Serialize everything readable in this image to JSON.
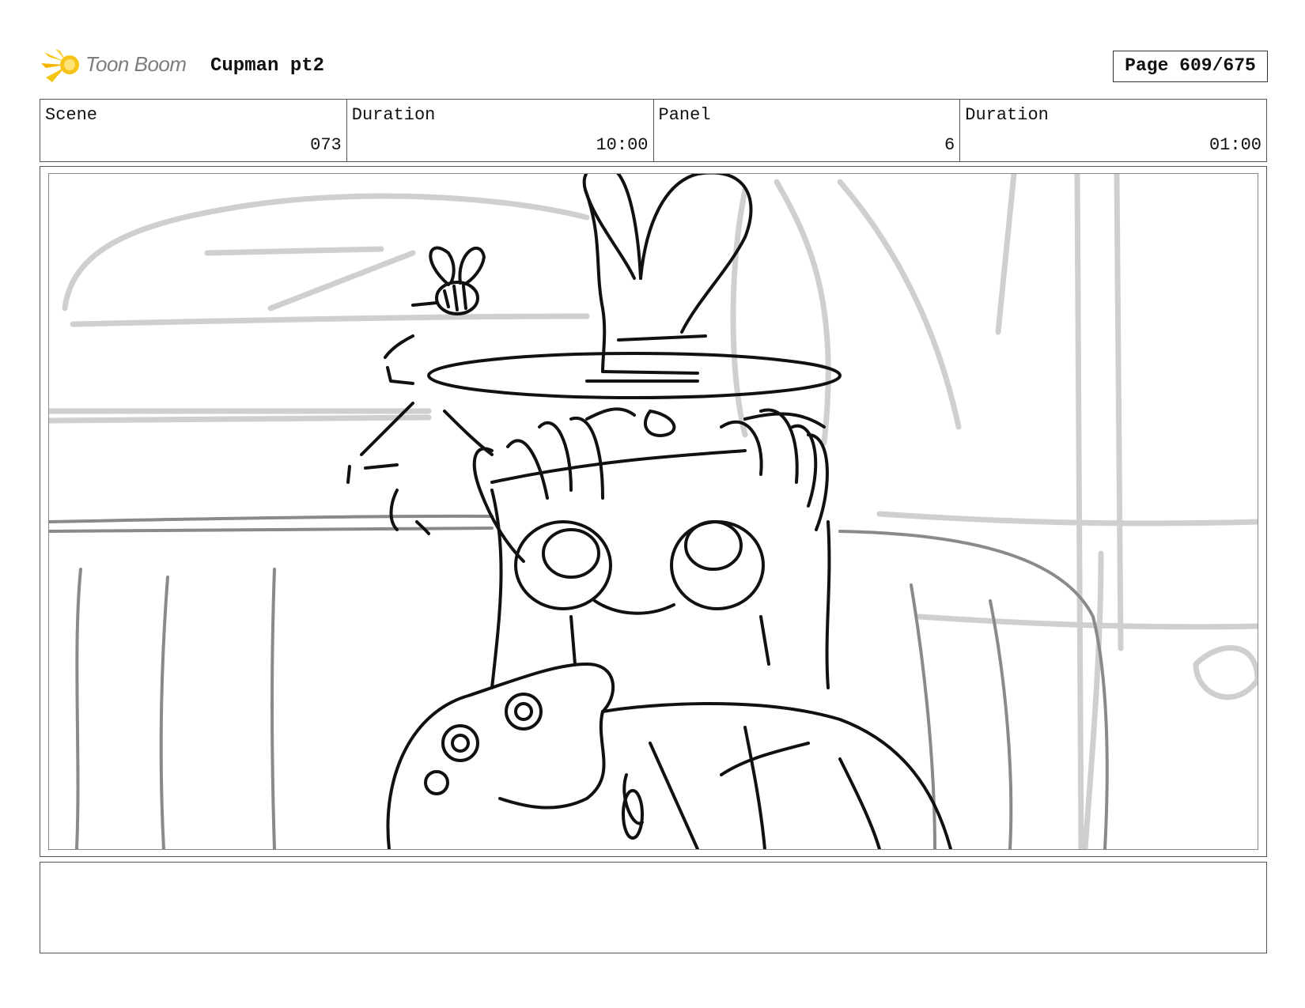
{
  "header": {
    "logo_text": "Toon Boom",
    "project_title": "Cupman pt2",
    "page_label": "Page 609/675"
  },
  "info": {
    "scene_label": "Scene",
    "scene_value": "073",
    "scene_duration_label": "Duration",
    "scene_duration_value": "10:00",
    "panel_label": "Panel",
    "panel_value": "6",
    "panel_duration_label": "Duration",
    "panel_duration_value": "01:00"
  },
  "colors": {
    "logo_star": "#f5c518",
    "logo_text": "#7d7d7d",
    "sketch_line": "#111111",
    "background_sketch": "#cfcfcf"
  },
  "panel": {
    "image": "storyboard-sketch",
    "notes": ""
  }
}
